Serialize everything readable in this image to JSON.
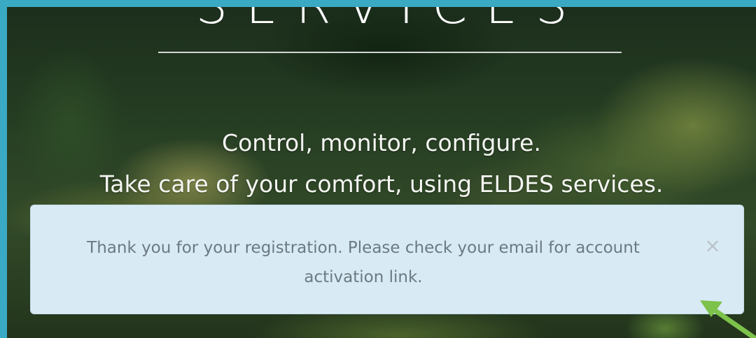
{
  "hero": {
    "heading": "SERVICES",
    "tagline_line1": "Control, monitor, configure.",
    "tagline_line2": "Take care of your comfort, using ELDES services."
  },
  "alert": {
    "message": "Thank you for your registration. Please check your email for account activation link.",
    "close_label": "×",
    "close_icon": "close-icon"
  },
  "annotation": {
    "arrow_icon": "green-arrow-icon",
    "arrow_color": "#7dc24b"
  },
  "colors": {
    "frame_border": "#3aa9c4",
    "alert_background": "#d8eaf4",
    "alert_text": "#6b7a82"
  }
}
